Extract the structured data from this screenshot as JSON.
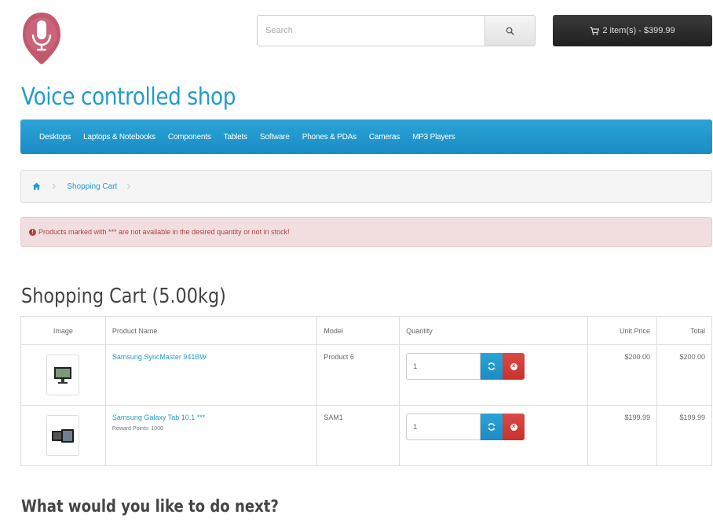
{
  "header": {
    "search_placeholder": "Search",
    "cart_button_label": "2 item(s) - $399.99"
  },
  "site": {
    "title": "Voice controlled shop"
  },
  "nav": {
    "items": [
      "Desktops",
      "Laptops & Notebooks",
      "Components",
      "Tablets",
      "Software",
      "Phones & PDAs",
      "Cameras",
      "MP3 Players"
    ]
  },
  "breadcrumb": {
    "current": "Shopping Cart"
  },
  "alert": {
    "text": "Products marked with *** are not available in the desired quantity or not in stock!"
  },
  "page": {
    "title": "Shopping Cart  (5.00kg)",
    "next_title": "What would you like to do next?"
  },
  "table": {
    "headers": [
      "Image",
      "Product Name",
      "Model",
      "Quantity",
      "Unit Price",
      "Total"
    ],
    "rows": [
      {
        "name": "Samsung SyncMaster 941BW",
        "reward": "",
        "model": "Product 6",
        "quantity": "1",
        "unit_price": "$200.00",
        "total": "$200.00",
        "thumb_icon": "monitor-icon"
      },
      {
        "name": "Samsung Galaxy Tab 10.1 ***",
        "reward": "Reward Points: 1000",
        "model": "SAM1",
        "quantity": "1",
        "unit_price": "$199.99",
        "total": "$199.99",
        "thumb_icon": "tablet-icon"
      }
    ]
  },
  "colors": {
    "accent": "#239bcd",
    "danger": "#cd3a35",
    "alert_bg": "#f2dede",
    "dark": "#2a2a2a"
  }
}
